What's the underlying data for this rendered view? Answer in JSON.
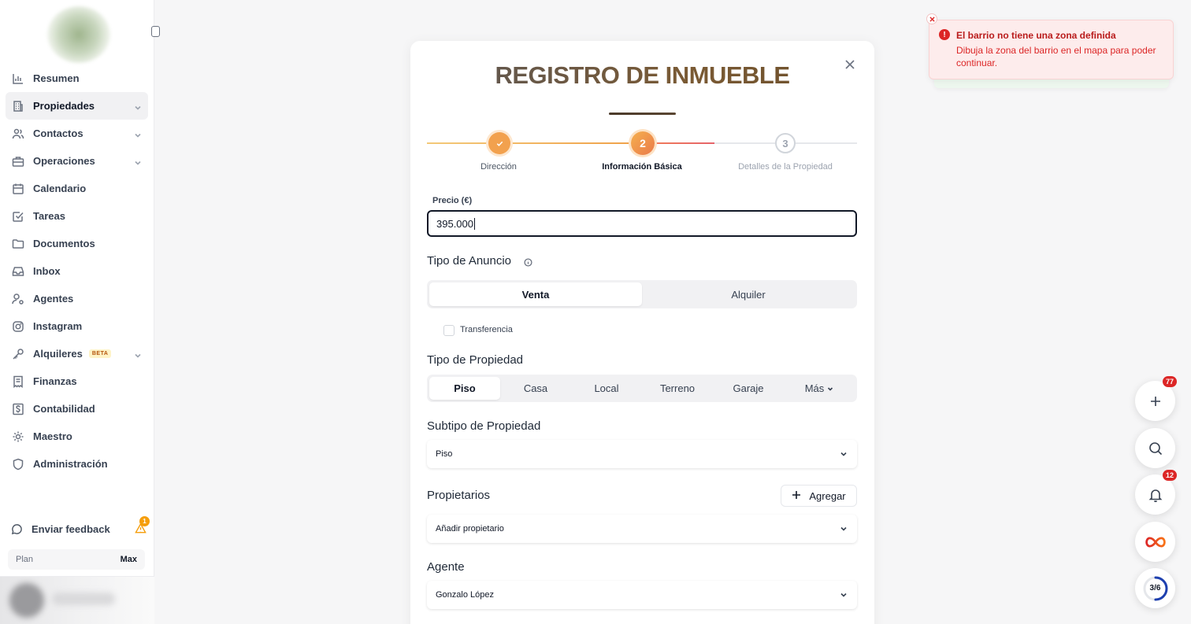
{
  "sidebar": {
    "items": [
      {
        "label": "Resumen",
        "icon": "bar-chart-icon",
        "active": false,
        "chevron": false
      },
      {
        "label": "Propiedades",
        "icon": "building-icon",
        "active": true,
        "chevron": true
      },
      {
        "label": "Contactos",
        "icon": "users-icon",
        "active": false,
        "chevron": true
      },
      {
        "label": "Operaciones",
        "icon": "briefcase-icon",
        "active": false,
        "chevron": true
      },
      {
        "label": "Calendario",
        "icon": "calendar-icon",
        "active": false,
        "chevron": false
      },
      {
        "label": "Tareas",
        "icon": "checkbox-icon",
        "active": false,
        "chevron": false
      },
      {
        "label": "Documentos",
        "icon": "folder-icon",
        "active": false,
        "chevron": false
      },
      {
        "label": "Inbox",
        "icon": "inbox-icon",
        "active": false,
        "chevron": false
      },
      {
        "label": "Agentes",
        "icon": "user-cog-icon",
        "active": false,
        "chevron": false
      },
      {
        "label": "Instagram",
        "icon": "instagram-icon",
        "active": false,
        "chevron": false
      },
      {
        "label": "Alquileres",
        "icon": "key-icon",
        "active": false,
        "chevron": true,
        "badge": "BETA"
      },
      {
        "label": "Finanzas",
        "icon": "receipt-icon",
        "active": false,
        "chevron": false
      },
      {
        "label": "Contabilidad",
        "icon": "dollar-icon",
        "active": false,
        "chevron": false
      },
      {
        "label": "Maestro",
        "icon": "gear-icon",
        "active": false,
        "chevron": false
      },
      {
        "label": "Administración",
        "icon": "shield-icon",
        "active": false,
        "chevron": false
      }
    ],
    "feedback_label": "Enviar feedback",
    "feedback_alert_count": "1",
    "plan_label": "Plan",
    "plan_value": "Max"
  },
  "modal": {
    "title": "REGISTRO DE INMUEBLE",
    "steps": [
      {
        "number": "1",
        "label": "Dirección",
        "status": "completed"
      },
      {
        "number": "2",
        "label": "Información Básica",
        "status": "current"
      },
      {
        "number": "3",
        "label": "Detalles de la Propiedad",
        "status": "pending"
      }
    ],
    "price_label": "Precio (€)",
    "price_value": "395.000",
    "listing_type_title": "Tipo de Anuncio",
    "listing_options": [
      "Venta",
      "Alquiler"
    ],
    "listing_selected": "Venta",
    "transfer_label": "Transferencia",
    "transfer_checked": false,
    "property_type_title": "Tipo de Propiedad",
    "property_options": [
      "Piso",
      "Casa",
      "Local",
      "Terreno",
      "Garaje",
      "Más"
    ],
    "property_selected": "Piso",
    "subtype_title": "Subtipo de Propiedad",
    "subtype_value": "Piso",
    "owners_title": "Propietarios",
    "add_button_label": "Agregar",
    "owners_placeholder": "Añadir propietario",
    "agent_title": "Agente",
    "agent_value": "Gonzalo López"
  },
  "toast": {
    "title": "El barrio no tiene una zona definida",
    "message": "Dibuja la zona del barrio en el mapa para poder continuar.",
    "icon": "alert-circle-icon",
    "color": "#dc2626"
  },
  "fabs": {
    "add_badge": "77",
    "notifications_badge": "12",
    "progress_text": "3/6",
    "progress_fraction": 0.5
  },
  "colors": {
    "accent_orange": "#f0a24a",
    "step_done": "#f2a14e",
    "step_current": "#ee8a4a",
    "error": "#dc2626"
  }
}
